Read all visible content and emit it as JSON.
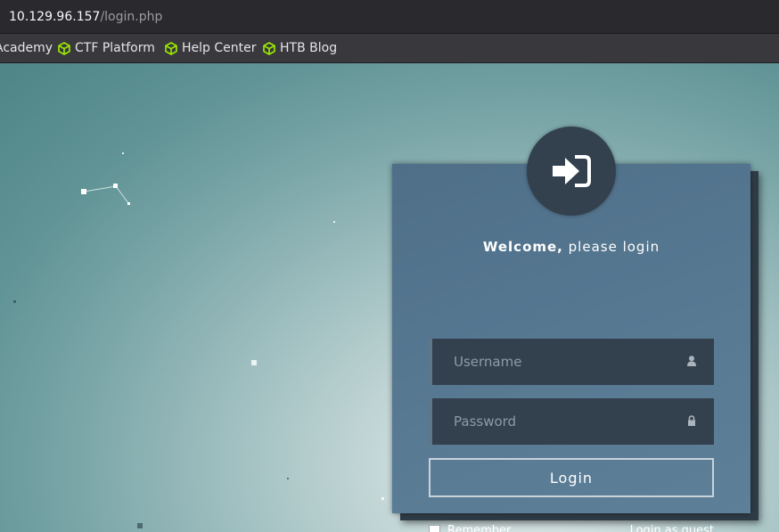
{
  "browser": {
    "url_host": "10.129.96.157",
    "url_path": "/login.php"
  },
  "bookmarks": [
    {
      "label": "Academy",
      "icon": "none"
    },
    {
      "label": "CTF Platform",
      "icon": "htb-cube-icon"
    },
    {
      "label": "Help Center",
      "icon": "htb-cube-icon"
    },
    {
      "label": "HTB Blog",
      "icon": "htb-cube-icon"
    }
  ],
  "colors": {
    "bookmark_icon": "#9fef00",
    "card_bg": "#587a93",
    "field_bg": "#33404e"
  },
  "login": {
    "welcome_bold": "Welcome,",
    "welcome_rest": " please login",
    "username_placeholder": "Username",
    "password_placeholder": "Password",
    "submit_label": "Login",
    "remember_label": "Remember",
    "guest_label": "Login as guest",
    "avatar_icon": "sign-in-icon",
    "username_icon": "user-icon",
    "password_icon": "lock-icon"
  }
}
